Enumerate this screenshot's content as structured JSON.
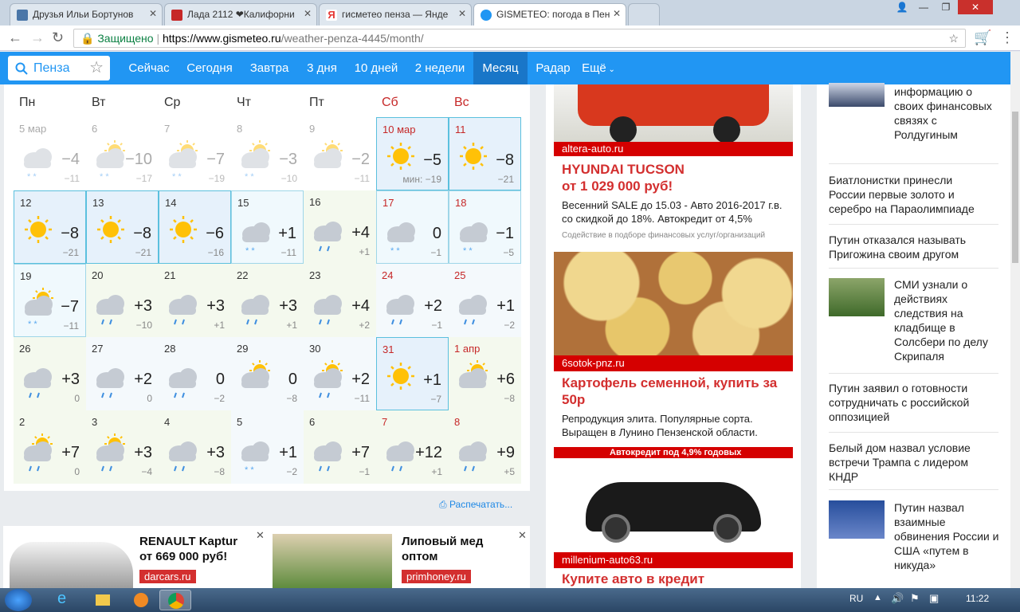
{
  "browser": {
    "tabs": [
      {
        "title": "Друзья Ильи Бортунов",
        "fav": "#4a76a8"
      },
      {
        "title": "Лада 2112 ❤Калифорни",
        "fav": "#c62828"
      },
      {
        "title": "гисметео пенза — Янде",
        "fav": "#ffdb4d"
      },
      {
        "title": "GISMETEO: погода в Пен",
        "fav": "#2196f3"
      }
    ],
    "secure": "Защищено",
    "url_domain": "https://www.gismeteo.ru",
    "url_path": "/weather-penza-4445/month/"
  },
  "nav": {
    "search": "Пенза",
    "items": [
      "Сейчас",
      "Сегодня",
      "Завтра",
      "3 дня",
      "10 дней",
      "2 недели",
      "Месяц",
      "Радар",
      "Ещё"
    ],
    "selected": "Месяц"
  },
  "weekdays": [
    "Пн",
    "Вт",
    "Ср",
    "Чт",
    "Пт",
    "Сб",
    "Вс"
  ],
  "calendar": [
    [
      {
        "d": "5 мар",
        "t": "−4",
        "m": "−11",
        "ic": "cloud-snow"
      },
      {
        "d": "6",
        "t": "−10",
        "m": "−17",
        "ic": "pcloud-snow"
      },
      {
        "d": "7",
        "t": "−7",
        "m": "−19",
        "ic": "pcloud-snow"
      },
      {
        "d": "8",
        "t": "−3",
        "m": "−10",
        "ic": "pcloud-snow"
      },
      {
        "d": "9",
        "t": "−2",
        "m": "−11",
        "ic": "pcloud"
      },
      {
        "d": "10 мар",
        "t": "−5",
        "m": "мин: −19",
        "ic": "sun"
      },
      {
        "d": "11",
        "t": "−8",
        "m": "−21",
        "ic": "sun"
      }
    ],
    [
      {
        "d": "12",
        "t": "−8",
        "m": "−21",
        "ic": "sun"
      },
      {
        "d": "13",
        "t": "−8",
        "m": "−21",
        "ic": "sun"
      },
      {
        "d": "14",
        "t": "−6",
        "m": "−16",
        "ic": "sun"
      },
      {
        "d": "15",
        "t": "+1",
        "m": "−11",
        "ic": "cloud-snow"
      },
      {
        "d": "16",
        "t": "+4",
        "m": "+1",
        "ic": "cloud-rain"
      },
      {
        "d": "17",
        "t": "0",
        "m": "−1",
        "ic": "cloud-snow"
      },
      {
        "d": "18",
        "t": "−1",
        "m": "−5",
        "ic": "cloud-snow"
      }
    ],
    [
      {
        "d": "19",
        "t": "−7",
        "m": "−11",
        "ic": "pcloud-snow"
      },
      {
        "d": "20",
        "t": "+3",
        "m": "−10",
        "ic": "cloud-rain"
      },
      {
        "d": "21",
        "t": "+3",
        "m": "+1",
        "ic": "cloud-rain"
      },
      {
        "d": "22",
        "t": "+3",
        "m": "+1",
        "ic": "cloud-rain"
      },
      {
        "d": "23",
        "t": "+4",
        "m": "+2",
        "ic": "cloud-rain"
      },
      {
        "d": "24",
        "t": "+2",
        "m": "−1",
        "ic": "cloud-rain"
      },
      {
        "d": "25",
        "t": "+1",
        "m": "−2",
        "ic": "cloud-rain"
      }
    ],
    [
      {
        "d": "26",
        "t": "+3",
        "m": "0",
        "ic": "cloud-rain"
      },
      {
        "d": "27",
        "t": "+2",
        "m": "0",
        "ic": "cloud-rain"
      },
      {
        "d": "28",
        "t": "0",
        "m": "−2",
        "ic": "cloud-rain"
      },
      {
        "d": "29",
        "t": "0",
        "m": "−8",
        "ic": "pcloud"
      },
      {
        "d": "30",
        "t": "+2",
        "m": "−11",
        "ic": "pcloud-rain"
      },
      {
        "d": "31",
        "t": "+1",
        "m": "−7",
        "ic": "sun"
      },
      {
        "d": "1 апр",
        "t": "+6",
        "m": "−8",
        "ic": "pcloud"
      }
    ],
    [
      {
        "d": "2",
        "t": "+7",
        "m": "0",
        "ic": "pcloud-rain"
      },
      {
        "d": "3",
        "t": "+3",
        "m": "−4",
        "ic": "pcloud-rain"
      },
      {
        "d": "4",
        "t": "+3",
        "m": "−8",
        "ic": "cloud-rain"
      },
      {
        "d": "5",
        "t": "+1",
        "m": "−2",
        "ic": "cloud-snow"
      },
      {
        "d": "6",
        "t": "+7",
        "m": "−1",
        "ic": "cloud-rain"
      },
      {
        "d": "7",
        "t": "+12",
        "m": "+1",
        "ic": "cloud-rain"
      },
      {
        "d": "8",
        "t": "+9",
        "m": "+5",
        "ic": "cloud-rain"
      }
    ]
  ],
  "print": "Распечатать...",
  "bottom_ads": [
    {
      "title": "RENAULT Kaptur\nот 669 000 руб!",
      "source": "darcars.ru"
    },
    {
      "title": "Липовый мед\nоптом",
      "source": "primhoney.ru"
    }
  ],
  "mid_ads": [
    {
      "source": "altera-auto.ru",
      "title": "HYUNDAI TUCSON\nот 1 029 000 руб!",
      "text": "Весенний SALE до 15.03 - Авто 2016-2017 г.в. со скидкой до 18%. Автокредит от 4,5%",
      "note": "Содействие в подборе финансовых услуг/организаций"
    },
    {
      "source": "6sotok-pnz.ru",
      "title": "Картофель семенной, купить за 50р",
      "text": "Репродукция элита. Популярные сорта. Выращен в Лунино Пензенской области."
    },
    {
      "banner": "Автокредит под 4,9% годовых",
      "source": "millenium-auto63.ru",
      "title": "Купите авто в кредит"
    }
  ],
  "news": [
    "информацию о своих финансовых связях с Ролдугиным",
    "Биатлонистки принесли России первые золото и серебро на Параолимпиаде",
    "Путин отказался называть Пригожина своим другом",
    "СМИ узнали о действиях следствия на кладбище в Солсбери по делу Скрипаля",
    "Путин заявил о готовности сотрудничать с российской оппозицией",
    "Белый дом назвал условие встречи Трампа с лидером КНДР",
    "Путин назвал взаимные обвинения России и США «путем в никуда»"
  ],
  "taskbar": {
    "lang": "RU",
    "time": "11:22"
  }
}
